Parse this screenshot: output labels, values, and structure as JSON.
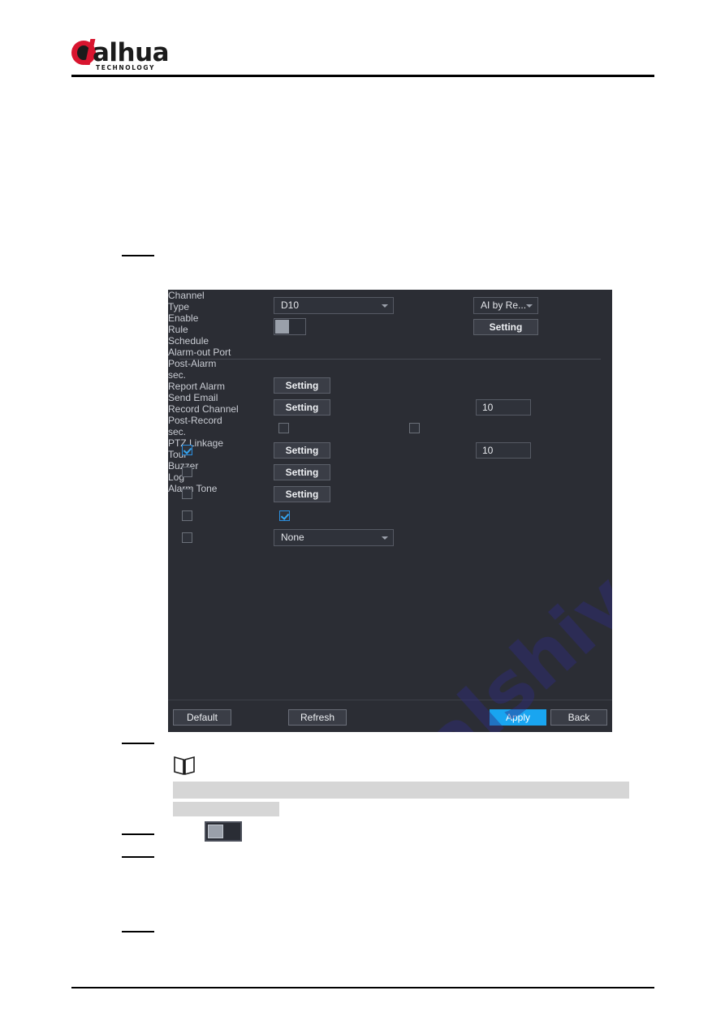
{
  "brand": {
    "name": "alhua",
    "tagline": "TECHNOLOGY"
  },
  "watermark": {
    "text": "manualshive.com"
  },
  "dialog": {
    "fields": {
      "channel_label": "Channel",
      "channel_value": "D10",
      "type_label": "Type",
      "type_value": "AI by Re...",
      "enable_label": "Enable",
      "enable_state": "off",
      "rule_label": "Rule",
      "rule_button": "Setting",
      "schedule_label": "Schedule",
      "schedule_button": "Setting",
      "alarm_out_label": "Alarm-out Port",
      "alarm_out_button": "Setting",
      "post_alarm_label": "Post-Alarm",
      "post_alarm_value": "10",
      "post_alarm_unit": "sec.",
      "report_alarm_label": "Report Alarm",
      "send_email_label": "Send Email",
      "record_channel_label": "Record Channel",
      "record_channel_button": "Setting",
      "post_record_label": "Post-Record",
      "post_record_value": "10",
      "post_record_unit": "sec.",
      "ptz_linkage_label": "PTZ Linkage",
      "ptz_linkage_button": "Setting",
      "tour_label": "Tour",
      "tour_button": "Setting",
      "buzzer_label": "Buzzer",
      "log_label": "Log",
      "alarm_tone_label": "Alarm Tone",
      "alarm_tone_value": "None"
    },
    "footer": {
      "default_button": "Default",
      "refresh_button": "Refresh",
      "apply_button": "Apply",
      "back_button": "Back"
    },
    "colors": {
      "background": "#2b2d34",
      "accent": "#19a5f0",
      "checkbox_checked": "#35a4f0"
    }
  }
}
